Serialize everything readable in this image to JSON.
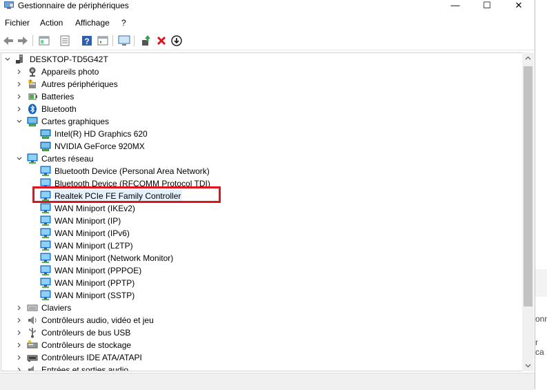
{
  "window": {
    "title": "Gestionnaire de périphériques",
    "minimize": "—",
    "maximize": "☐",
    "close": "✕"
  },
  "menu": [
    "Fichier",
    "Action",
    "Affichage",
    "?"
  ],
  "toolbar": [
    "back-icon",
    "forward-icon",
    "properties-icon",
    "list-icon",
    "help-icon",
    "details-icon",
    "monitor-icon",
    "update-driver-icon",
    "uninstall-icon",
    "install-icon"
  ],
  "tree": {
    "root": "DESKTOP-TD5G42T",
    "nodes": [
      {
        "label": "Appareils photo",
        "state": "collapsed",
        "level": 1,
        "icon": "camera-icon"
      },
      {
        "label": "Autres périphériques",
        "state": "collapsed",
        "level": 1,
        "icon": "other-device-icon"
      },
      {
        "label": "Batteries",
        "state": "collapsed",
        "level": 1,
        "icon": "battery-icon"
      },
      {
        "label": "Bluetooth",
        "state": "collapsed",
        "level": 1,
        "icon": "bluetooth-icon"
      },
      {
        "label": "Cartes graphiques",
        "state": "expanded",
        "level": 1,
        "icon": "display-adapter-icon"
      },
      {
        "label": "Intel(R) HD Graphics 620",
        "state": "leaf",
        "level": 2,
        "icon": "display-adapter-icon"
      },
      {
        "label": "NVIDIA GeForce 920MX",
        "state": "leaf",
        "level": 2,
        "icon": "display-adapter-icon"
      },
      {
        "label": "Cartes réseau",
        "state": "expanded",
        "level": 1,
        "icon": "network-adapter-icon"
      },
      {
        "label": "Bluetooth Device (Personal Area Network)",
        "state": "leaf",
        "level": 2,
        "icon": "network-adapter-icon"
      },
      {
        "label": "Bluetooth Device (RFCOMM Protocol TDI)",
        "state": "leaf",
        "level": 2,
        "icon": "network-adapter-icon"
      },
      {
        "label": "Realtek PCIe FE Family Controller",
        "state": "leaf",
        "level": 2,
        "icon": "network-adapter-icon",
        "selected": true
      },
      {
        "label": "WAN Miniport (IKEv2)",
        "state": "leaf",
        "level": 2,
        "icon": "network-adapter-icon"
      },
      {
        "label": "WAN Miniport (IP)",
        "state": "leaf",
        "level": 2,
        "icon": "network-adapter-icon"
      },
      {
        "label": "WAN Miniport (IPv6)",
        "state": "leaf",
        "level": 2,
        "icon": "network-adapter-icon"
      },
      {
        "label": "WAN Miniport (L2TP)",
        "state": "leaf",
        "level": 2,
        "icon": "network-adapter-icon"
      },
      {
        "label": "WAN Miniport (Network Monitor)",
        "state": "leaf",
        "level": 2,
        "icon": "network-adapter-icon"
      },
      {
        "label": "WAN Miniport (PPPOE)",
        "state": "leaf",
        "level": 2,
        "icon": "network-adapter-icon"
      },
      {
        "label": "WAN Miniport (PPTP)",
        "state": "leaf",
        "level": 2,
        "icon": "network-adapter-icon"
      },
      {
        "label": "WAN Miniport (SSTP)",
        "state": "leaf",
        "level": 2,
        "icon": "network-adapter-icon"
      },
      {
        "label": "Claviers",
        "state": "collapsed",
        "level": 1,
        "icon": "keyboard-icon"
      },
      {
        "label": "Contrôleurs audio, vidéo et jeu",
        "state": "collapsed",
        "level": 1,
        "icon": "audio-icon"
      },
      {
        "label": "Contrôleurs de bus USB",
        "state": "collapsed",
        "level": 1,
        "icon": "usb-icon"
      },
      {
        "label": "Contrôleurs de stockage",
        "state": "collapsed",
        "level": 1,
        "icon": "storage-icon"
      },
      {
        "label": "Contrôleurs IDE ATA/ATAPI",
        "state": "collapsed",
        "level": 1,
        "icon": "ide-icon"
      },
      {
        "label": "Entrées et sorties audio",
        "state": "collapsed",
        "level": 1,
        "icon": "audio-io-icon"
      }
    ]
  },
  "behind_window": [
    "onn",
    "r ca"
  ],
  "colors": {
    "highlight": "#e0141e",
    "selection": "#e5f1fb",
    "monitor_blue": "#1e88d6"
  }
}
